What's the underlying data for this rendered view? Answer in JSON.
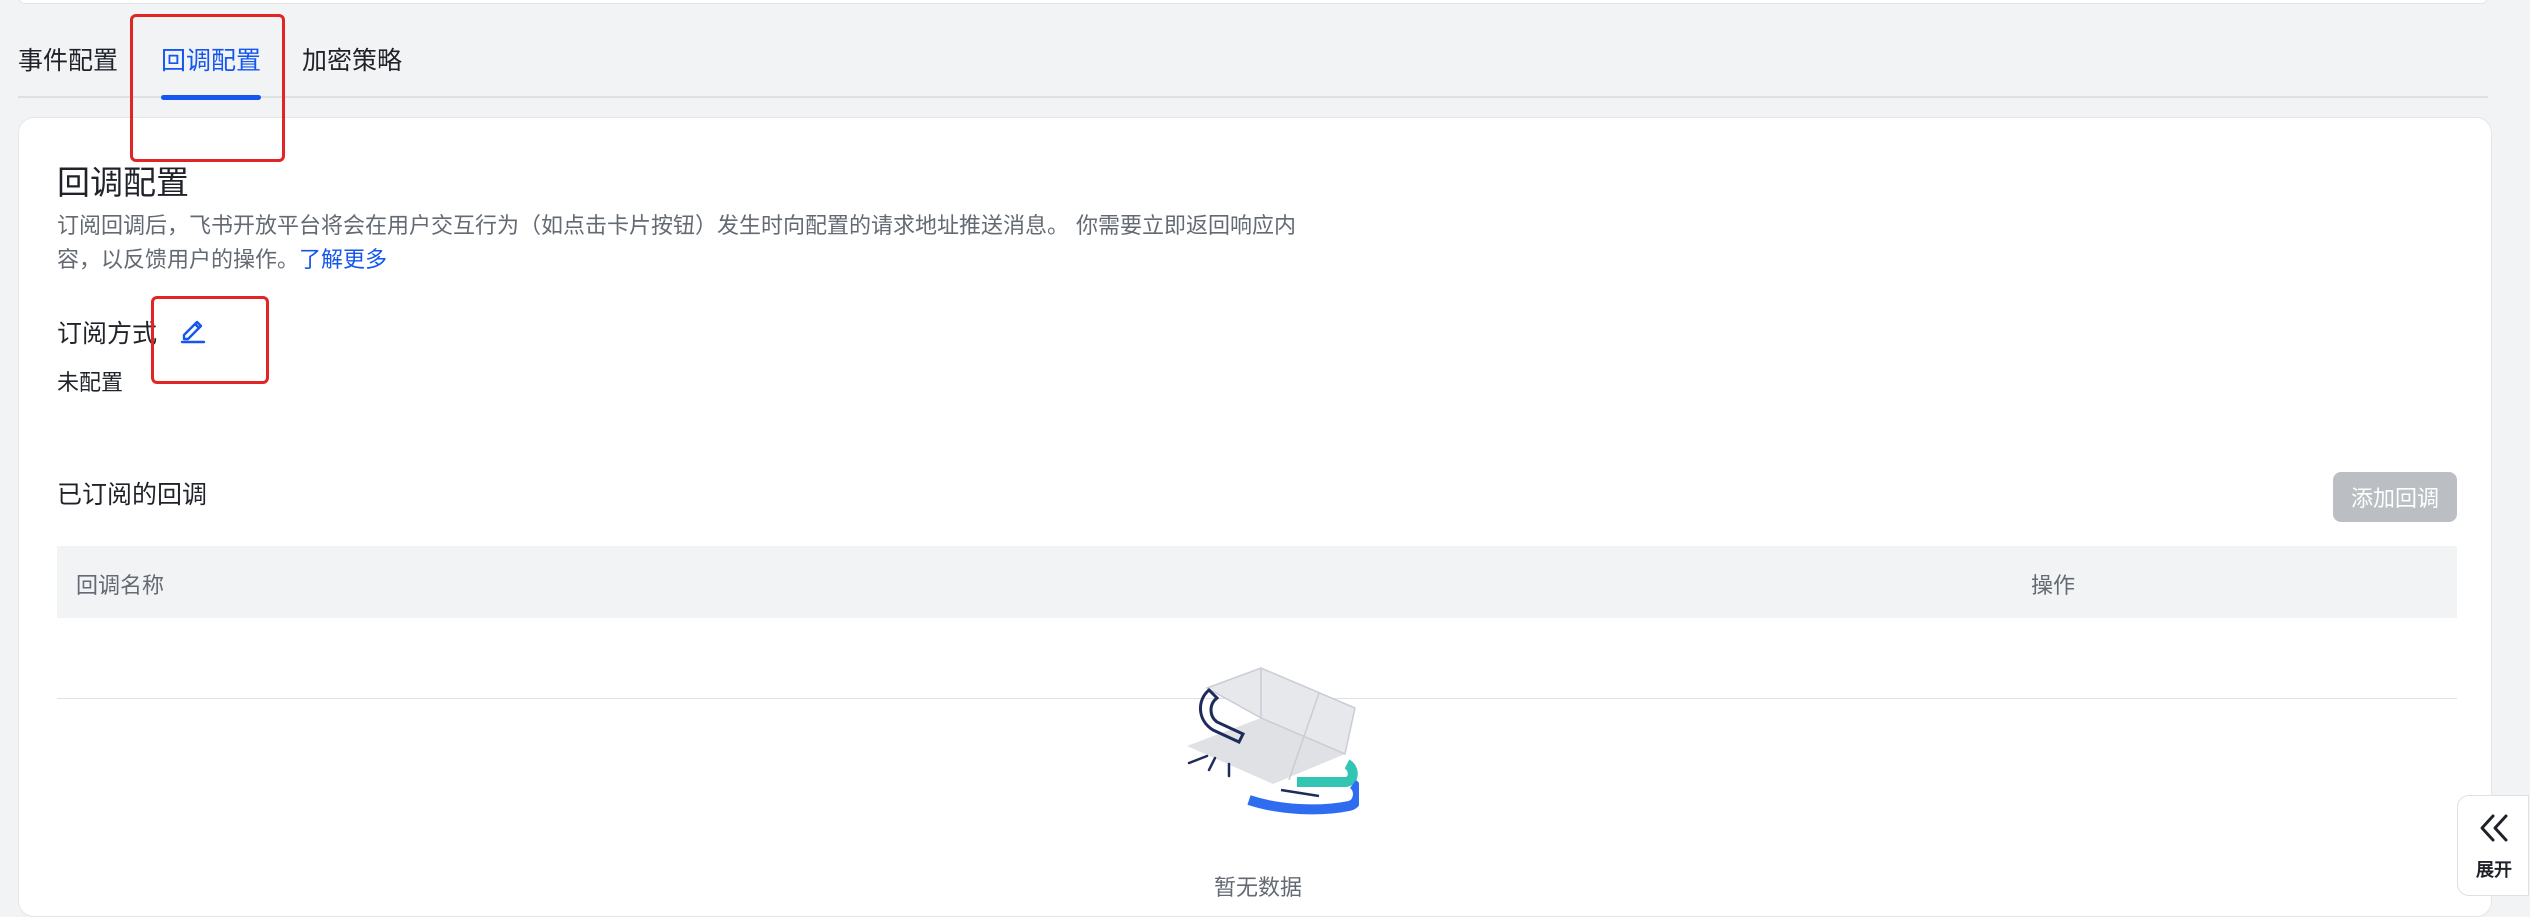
{
  "tabs": [
    {
      "label": "事件配置"
    },
    {
      "label": "回调配置"
    },
    {
      "label": "加密策略"
    }
  ],
  "section": {
    "title": "回调配置",
    "description": "订阅回调后，飞书开放平台将会在用户交互行为（如点击卡片按钮）发生时向配置的请求地址推送消息。 你需要立即返回响应内容，以反馈用户的操作。",
    "learn_more": "了解更多"
  },
  "subscription": {
    "label": "订阅方式",
    "value": "未配置"
  },
  "subscribed": {
    "title": "已订阅的回调",
    "add_button": "添加回调",
    "columns": [
      "回调名称",
      "操作"
    ],
    "rows": [],
    "empty_text": "暂无数据"
  },
  "expand": {
    "label": "展开"
  },
  "colors": {
    "accent": "#1456f0",
    "highlight": "#e32424",
    "disabled_button": "#bbbfc4"
  },
  "icons": [
    "edit-icon",
    "empty-illustration",
    "double-chevron-left-icon"
  ]
}
